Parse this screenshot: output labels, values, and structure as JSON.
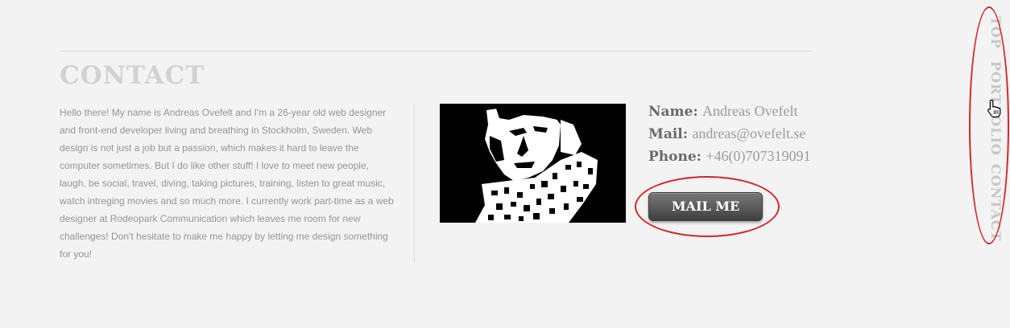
{
  "section": {
    "title": "CONTACT"
  },
  "bio": {
    "text": "Hello there! My name is Andreas Ovefelt and I'm a 26-year old web designer and front-end developer living and breathing in Stockholm, Sweden. Web design is not just a job but a passion, which makes it hard to leave the computer sometimes. But I do like other stuff! I love to meet new people, laugh, be social, travel, diving, taking pictures, training, listen to great music, watch intreging movies and so much more. I currently work part-time as a web designer at Rodeopark Communication which leaves me room for new challenges! Don't hesitate to make me happy by letting me design something for you!"
  },
  "contact": {
    "name_label": "Name:",
    "name_value": "Andreas Ovefelt",
    "mail_label": "Mail:",
    "mail_value": "andreas@ovefelt.se",
    "phone_label": "Phone:",
    "phone_value": "+46(0)707319091",
    "mail_button": "MAIL ME"
  },
  "side_nav": {
    "items": [
      {
        "label": "TOP"
      },
      {
        "label": "PORTFOLIO"
      },
      {
        "label": "CONTACT"
      }
    ]
  },
  "colors": {
    "background": "#f3f3f3",
    "annotation_ring": "#d3262c",
    "button": "#5a5a5a"
  },
  "icons": {
    "cursor": "hand-pointer-icon"
  }
}
